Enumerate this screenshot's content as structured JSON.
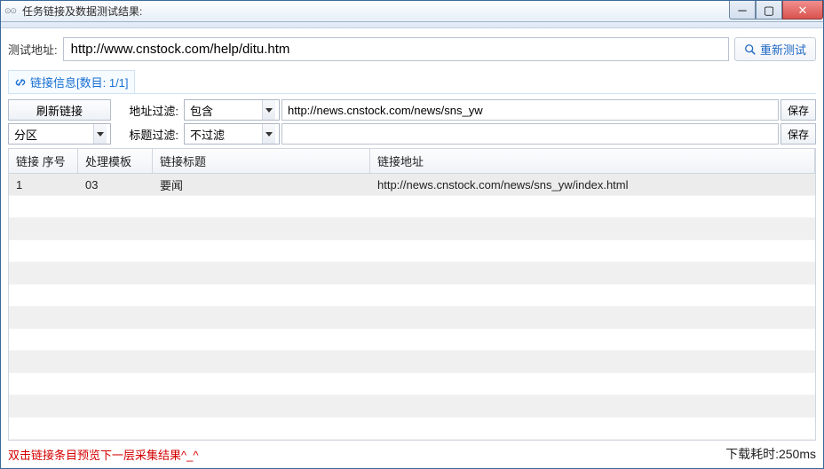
{
  "window": {
    "title": "任务链接及数据测试结果:"
  },
  "toolbar": {
    "test_url_label": "测试地址:",
    "retest_label": "重新测试"
  },
  "url_value": "http://www.cnstock.com/help/ditu.htm",
  "link_info_tab": "链接信息[数目: 1/1]",
  "filters": {
    "refresh_btn": "刷新链接",
    "addr_filter_label": "地址过滤:",
    "addr_filter_mode": "包含",
    "addr_filter_value": "http://news.cnstock.com/news/sns_yw",
    "title_filter_label": "标题过滤:",
    "title_filter_mode": "不过滤",
    "title_filter_value": "",
    "partition_label": "分区",
    "save_label": "保存"
  },
  "table": {
    "headers": {
      "seq": "链接 序号",
      "tmpl": "处理模板",
      "title": "链接标题",
      "url": "链接地址"
    },
    "rows": [
      {
        "seq": "1",
        "tmpl": "03",
        "title": "要闻",
        "url": "http://news.cnstock.com/news/sns_yw/index.html"
      }
    ]
  },
  "footer": {
    "hint": "双击链接条目预览下一层采集结果^_^",
    "timing": "下载耗时:250ms"
  }
}
